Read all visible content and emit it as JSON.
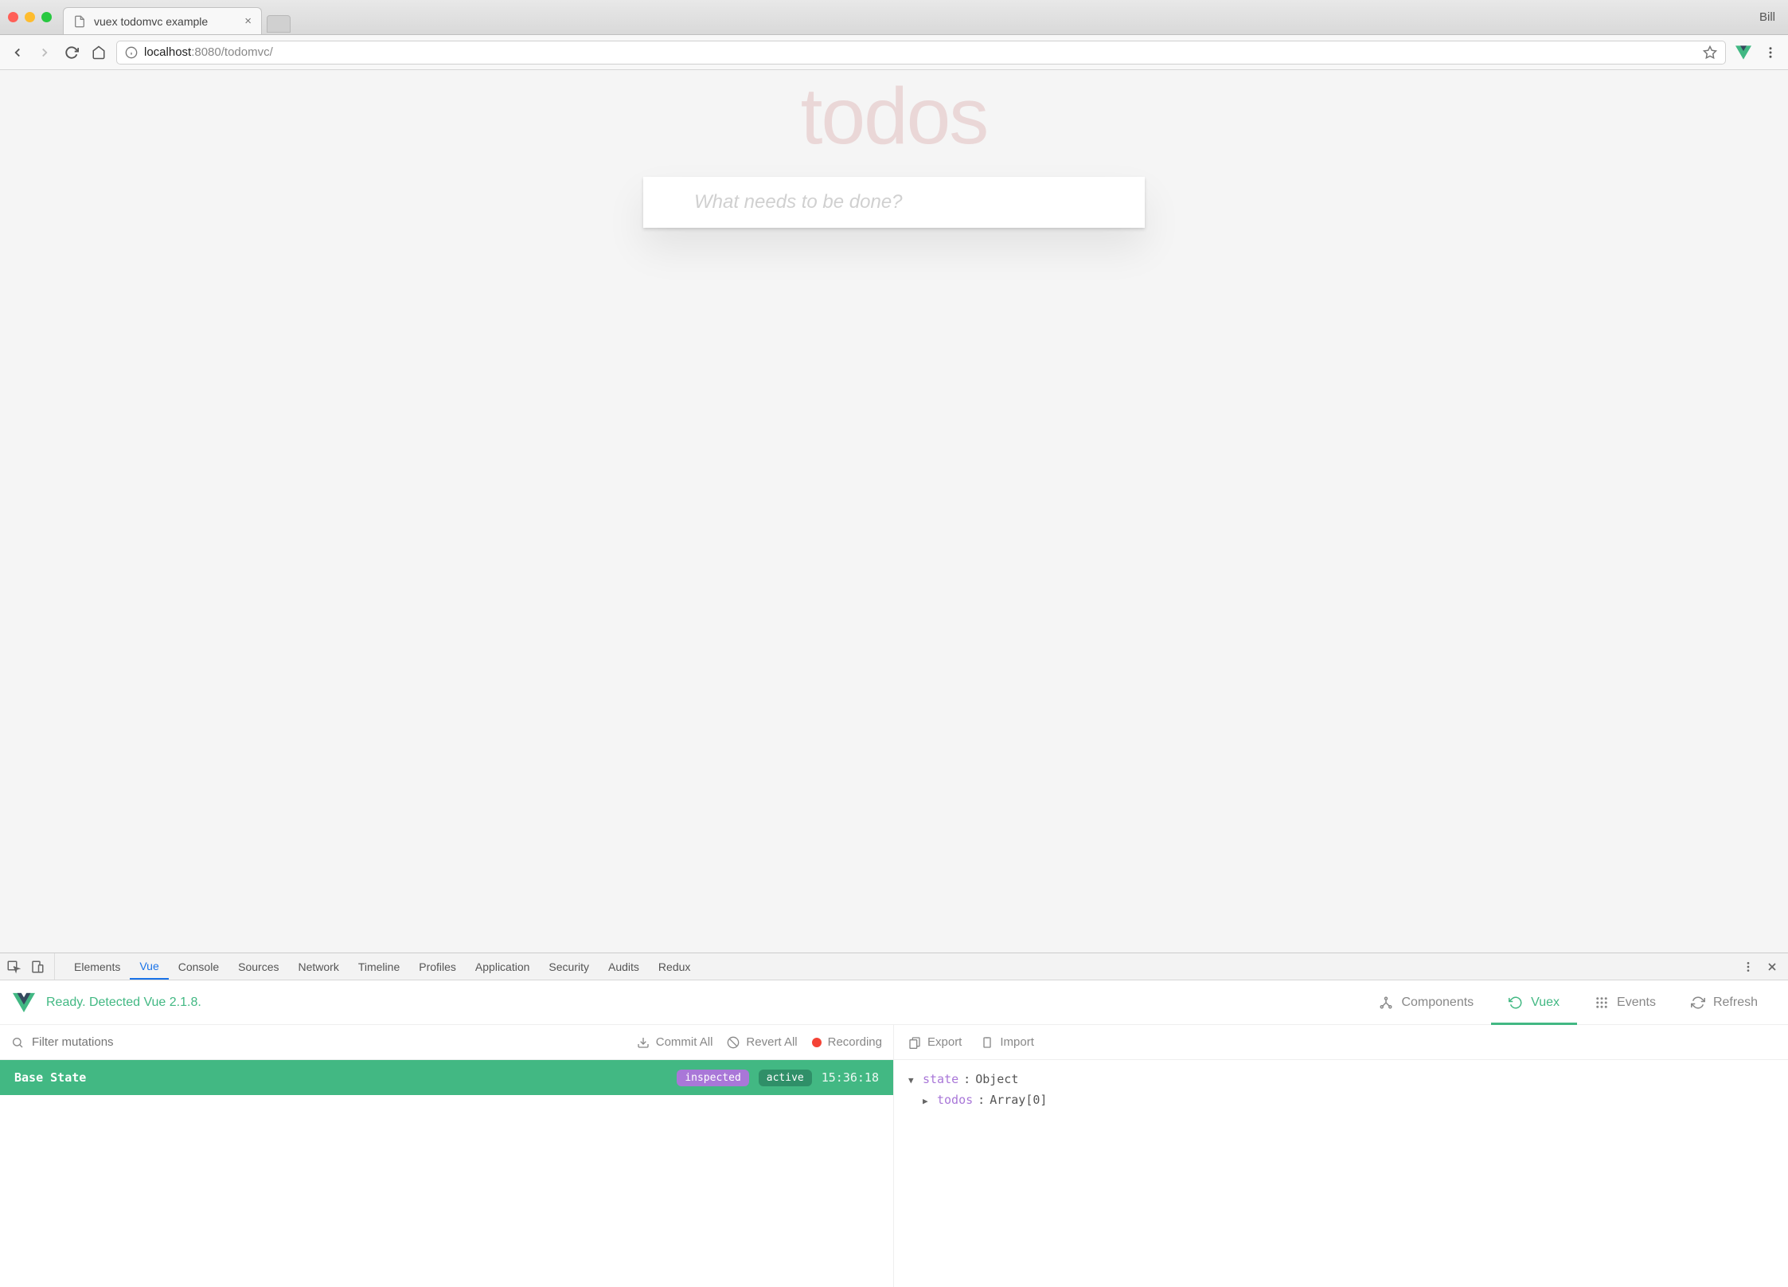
{
  "window": {
    "profile_name": "Bill",
    "tab_title": "vuex todomvc example"
  },
  "toolbar": {
    "url_host": "localhost",
    "url_port": ":8080",
    "url_path": "/todomvc/"
  },
  "page": {
    "title": "todos",
    "input_placeholder": "What needs to be done?"
  },
  "devtools": {
    "tabs": [
      "Elements",
      "Vue",
      "Console",
      "Sources",
      "Network",
      "Timeline",
      "Profiles",
      "Application",
      "Security",
      "Audits",
      "Redux"
    ],
    "active_tab": "Vue"
  },
  "vue_panel": {
    "status": "Ready. Detected Vue 2.1.8.",
    "nav": {
      "components": "Components",
      "vuex": "Vuex",
      "events": "Events",
      "refresh": "Refresh"
    },
    "mutation_toolbar": {
      "filter_placeholder": "Filter mutations",
      "commit_all": "Commit All",
      "revert_all": "Revert All",
      "recording": "Recording"
    },
    "mutation_row": {
      "label": "Base State",
      "inspected_badge": "inspected",
      "active_badge": "active",
      "timestamp": "15:36:18"
    },
    "state_toolbar": {
      "export": "Export",
      "import": "Import"
    },
    "state_tree": {
      "root_key": "state",
      "root_val": "Object",
      "child_key": "todos",
      "child_val": "Array[0]"
    }
  }
}
